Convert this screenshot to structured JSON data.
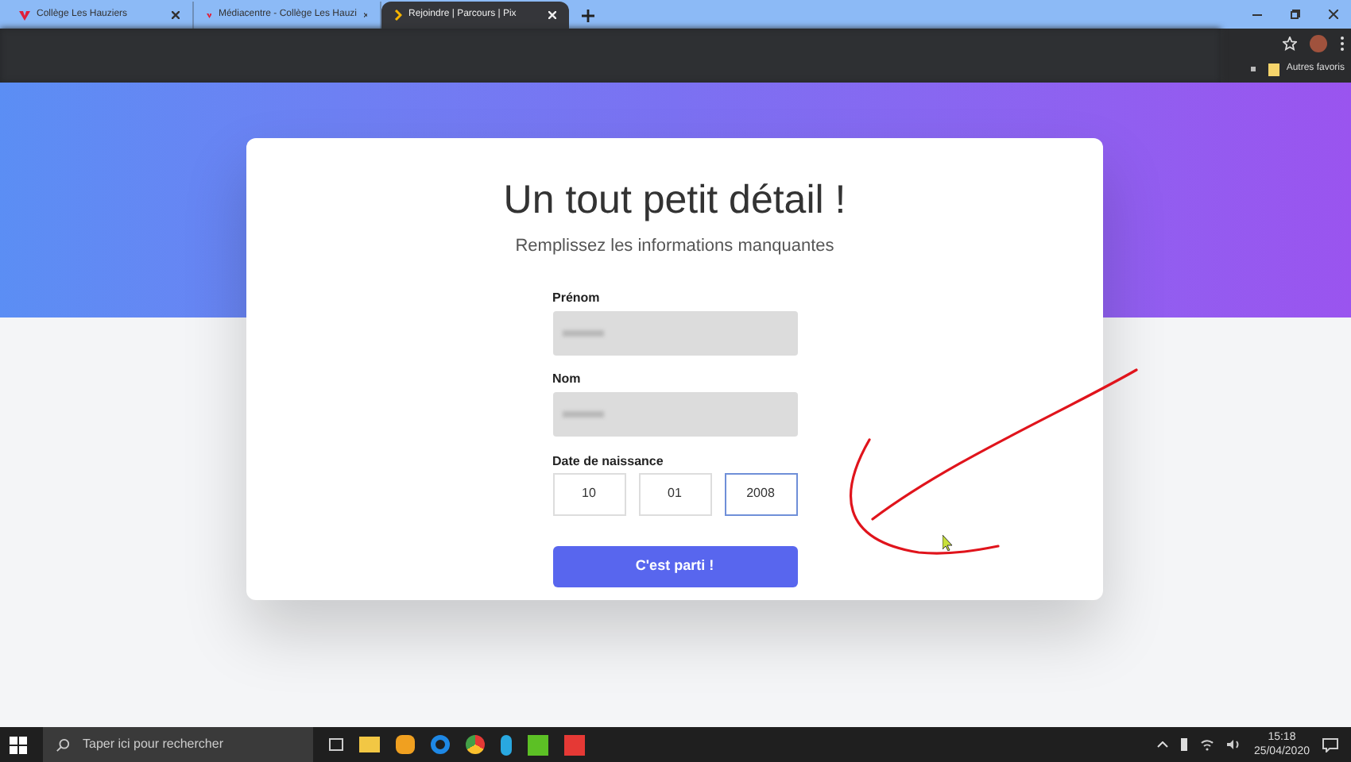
{
  "browser": {
    "tabs": [
      {
        "title": "Collège Les Hauziers",
        "selected": false,
        "kind": "school"
      },
      {
        "title": "Médiacentre - Collège Les Hauzi",
        "selected": false,
        "kind": "school"
      },
      {
        "title": "Rejoindre | Parcours | Pix",
        "selected": true,
        "kind": "pix"
      }
    ],
    "bookmarks": {
      "folder": "Autres favoris"
    }
  },
  "card": {
    "title": "Un tout petit détail !",
    "subtitle": "Remplissez les informations manquantes",
    "fields": [
      {
        "label": "Prénom",
        "disabled": true
      },
      {
        "label": "Nom",
        "disabled": true
      }
    ],
    "birthdate": {
      "label": "Date de naissance",
      "parts": [
        {
          "value": "10",
          "focused": false
        },
        {
          "value": "01",
          "focused": false
        },
        {
          "value": "2008",
          "focused": true
        }
      ]
    },
    "submit": "C'est parti !"
  },
  "taskbar": {
    "search_placeholder": "Taper ici pour rechercher",
    "time": "15:18",
    "date": "25/04/2020"
  }
}
